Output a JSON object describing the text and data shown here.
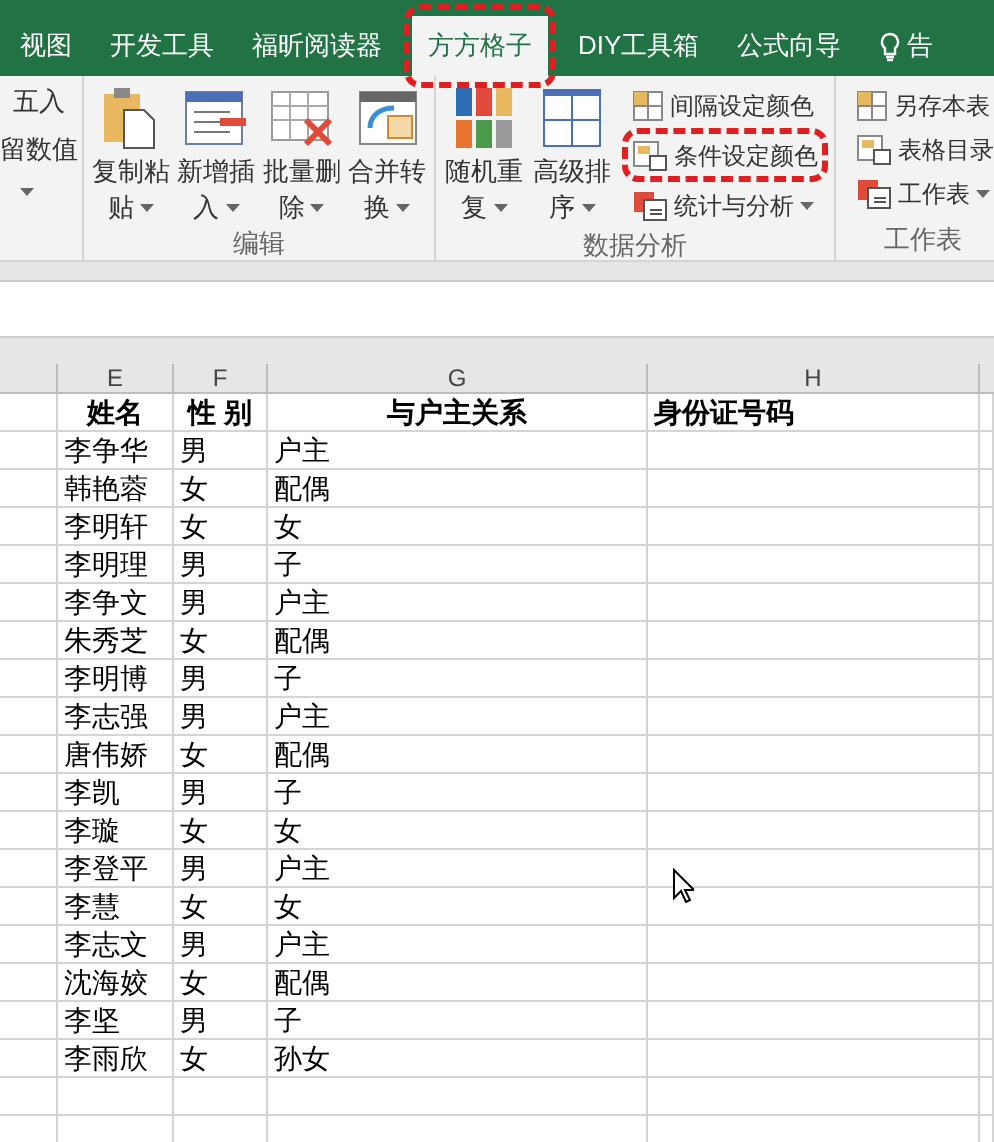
{
  "tabs": [
    {
      "label": "视图",
      "selected": false,
      "highlighted": false,
      "kind": "tab"
    },
    {
      "label": "开发工具",
      "selected": false,
      "highlighted": false,
      "kind": "tab"
    },
    {
      "label": "福昕阅读器",
      "selected": false,
      "highlighted": false,
      "kind": "tab"
    },
    {
      "label": "方方格子",
      "selected": true,
      "highlighted": true,
      "kind": "tab"
    },
    {
      "label": "DIY工具箱",
      "selected": false,
      "highlighted": false,
      "kind": "tab"
    },
    {
      "label": "公式向导",
      "selected": false,
      "highlighted": false,
      "kind": "tab"
    },
    {
      "label": "告",
      "selected": false,
      "highlighted": false,
      "kind": "tell"
    }
  ],
  "ribbon": {
    "groups": [
      {
        "items": [
          {
            "kind": "small",
            "label": "五入"
          },
          {
            "kind": "small",
            "label": "留数值"
          },
          {
            "kind": "caret"
          }
        ]
      },
      {
        "label": "编辑",
        "items": [
          {
            "kind": "large",
            "lines": [
              "复制粘",
              "贴"
            ],
            "caret": true
          },
          {
            "kind": "large",
            "lines": [
              "新增插",
              "入"
            ],
            "caret": true
          },
          {
            "kind": "large",
            "lines": [
              "批量删",
              "除"
            ],
            "caret": true
          },
          {
            "kind": "large",
            "lines": [
              "合并转",
              "换"
            ],
            "caret": true
          }
        ]
      },
      {
        "label": "数据分析",
        "items": [
          {
            "kind": "large",
            "lines": [
              "随机重",
              "复"
            ],
            "caret": true
          },
          {
            "kind": "large",
            "lines": [
              "高级排",
              "序"
            ],
            "caret": true
          },
          {
            "kind": "stack",
            "items": [
              {
                "label": "间隔设定颜色",
                "caret": false,
                "highlighted": false
              },
              {
                "label": "条件设定颜色",
                "caret": false,
                "highlighted": true
              },
              {
                "label": "统计与分析",
                "caret": true,
                "highlighted": false
              }
            ]
          }
        ]
      },
      {
        "label": "工作表",
        "items": [
          {
            "kind": "stack",
            "items": [
              {
                "label": "另存本表",
                "caret": false,
                "highlighted": false
              },
              {
                "label": "表格目录",
                "caret": false,
                "highlighted": false
              },
              {
                "label": "工作表",
                "caret": true,
                "highlighted": false
              }
            ]
          }
        ]
      }
    ]
  },
  "sheet": {
    "columns": [
      "E",
      "F",
      "G",
      "H"
    ],
    "header": [
      "姓名",
      "性 别",
      "与户主关系",
      "身份证号码"
    ],
    "rows": [
      [
        "李争华",
        "男",
        "户主"
      ],
      [
        "韩艳蓉",
        "女",
        "配偶"
      ],
      [
        "李明轩",
        "女",
        "女"
      ],
      [
        "李明理",
        "男",
        "子"
      ],
      [
        "李争文",
        "男",
        "户主"
      ],
      [
        "朱秀芝",
        "女",
        "配偶"
      ],
      [
        "李明博",
        "男",
        "子"
      ],
      [
        "李志强",
        "男",
        "户主"
      ],
      [
        "唐伟娇",
        "女",
        "配偶"
      ],
      [
        "李凯",
        "男",
        "子"
      ],
      [
        "李璇",
        "女",
        "女"
      ],
      [
        "李登平",
        "男",
        "户主"
      ],
      [
        "李慧",
        "女",
        "女"
      ],
      [
        "李志文",
        "男",
        "户主"
      ],
      [
        "沈海姣",
        "女",
        "配偶"
      ],
      [
        "李坚",
        "男",
        "子"
      ],
      [
        "李雨欣",
        "女",
        "孙女"
      ]
    ]
  }
}
